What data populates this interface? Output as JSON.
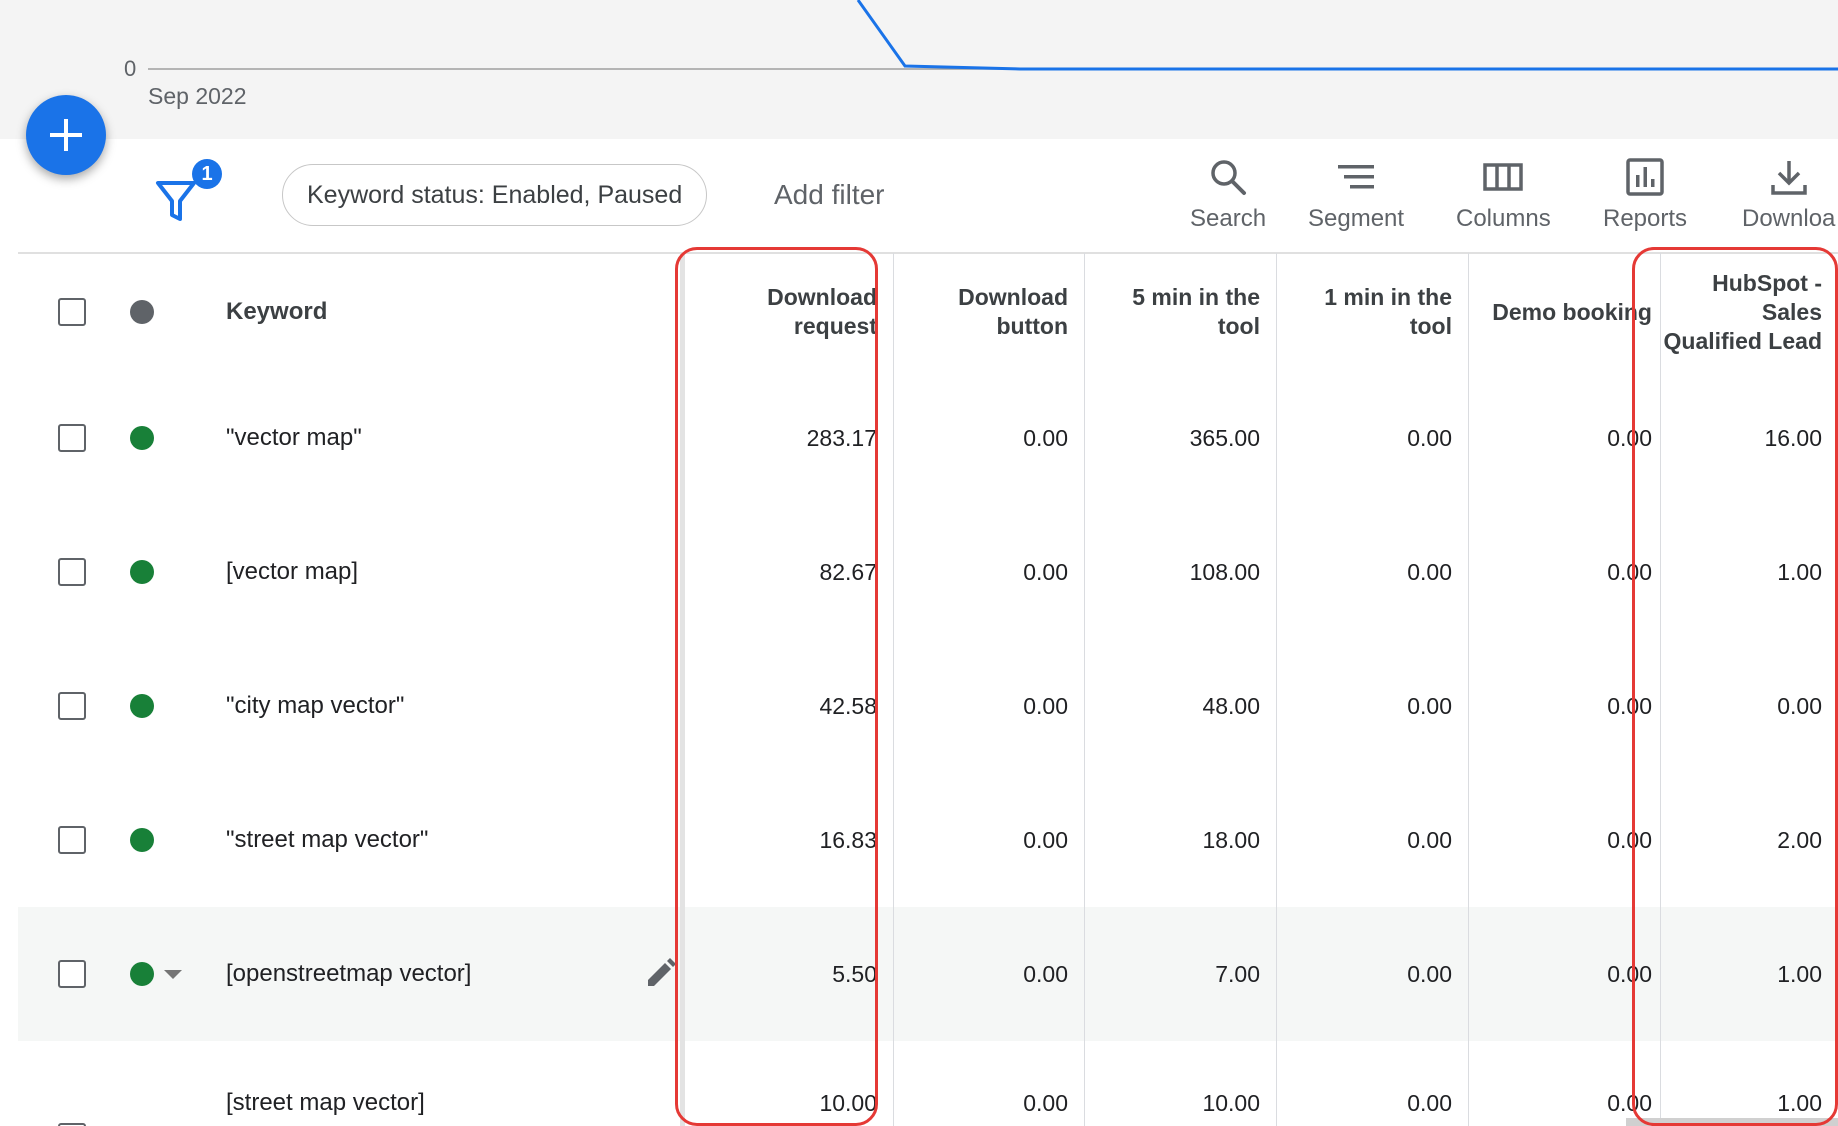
{
  "chart": {
    "y_zero": "0",
    "x_start_label": "Sep 2022",
    "line_color": "#1a73e8"
  },
  "toolbar": {
    "filter_badge": "1",
    "filter_chip": "Keyword status: Enabled, Paused",
    "add_filter": "Add filter",
    "search_label": "Search",
    "segment_label": "Segment",
    "columns_label": "Columns",
    "reports_label": "Reports",
    "download_label": "Downloa"
  },
  "table": {
    "headers": {
      "keyword": "Keyword",
      "download_request": [
        "Download",
        "request"
      ],
      "download_button": [
        "Download",
        "button"
      ],
      "five_min": [
        "5 min in the",
        "tool"
      ],
      "one_min": [
        "1 min in the",
        "tool"
      ],
      "demo_booking": [
        "Demo booking"
      ],
      "hubspot": [
        "HubSpot -",
        "Sales",
        "Qualified Lead"
      ]
    },
    "rows": [
      {
        "keyword": "\"vector map\"",
        "download_request": "283.17",
        "download_button": "0.00",
        "five_min": "365.00",
        "one_min": "0.00",
        "demo_booking": "0.00",
        "hubspot": "16.00"
      },
      {
        "keyword": "[vector map]",
        "download_request": "82.67",
        "download_button": "0.00",
        "five_min": "108.00",
        "one_min": "0.00",
        "demo_booking": "0.00",
        "hubspot": "1.00"
      },
      {
        "keyword": "\"city map vector\"",
        "download_request": "42.58",
        "download_button": "0.00",
        "five_min": "48.00",
        "one_min": "0.00",
        "demo_booking": "0.00",
        "hubspot": "0.00"
      },
      {
        "keyword": "\"street map vector\"",
        "download_request": "16.83",
        "download_button": "0.00",
        "five_min": "18.00",
        "one_min": "0.00",
        "demo_booking": "0.00",
        "hubspot": "2.00"
      },
      {
        "keyword": "[openstreetmap vector]",
        "download_request": "5.50",
        "download_button": "0.00",
        "five_min": "7.00",
        "one_min": "0.00",
        "demo_booking": "0.00",
        "hubspot": "1.00"
      },
      {
        "keyword": "[street map vector]",
        "download_request": "10.00",
        "download_button": "0.00",
        "five_min": "10.00",
        "one_min": "0.00",
        "demo_booking": "0.00",
        "hubspot": "1.00"
      }
    ]
  },
  "colors": {
    "accent": "#1a73e8",
    "enabled_green": "#188038",
    "header_dot": "#5f6368",
    "highlight_red": "#e53935"
  }
}
